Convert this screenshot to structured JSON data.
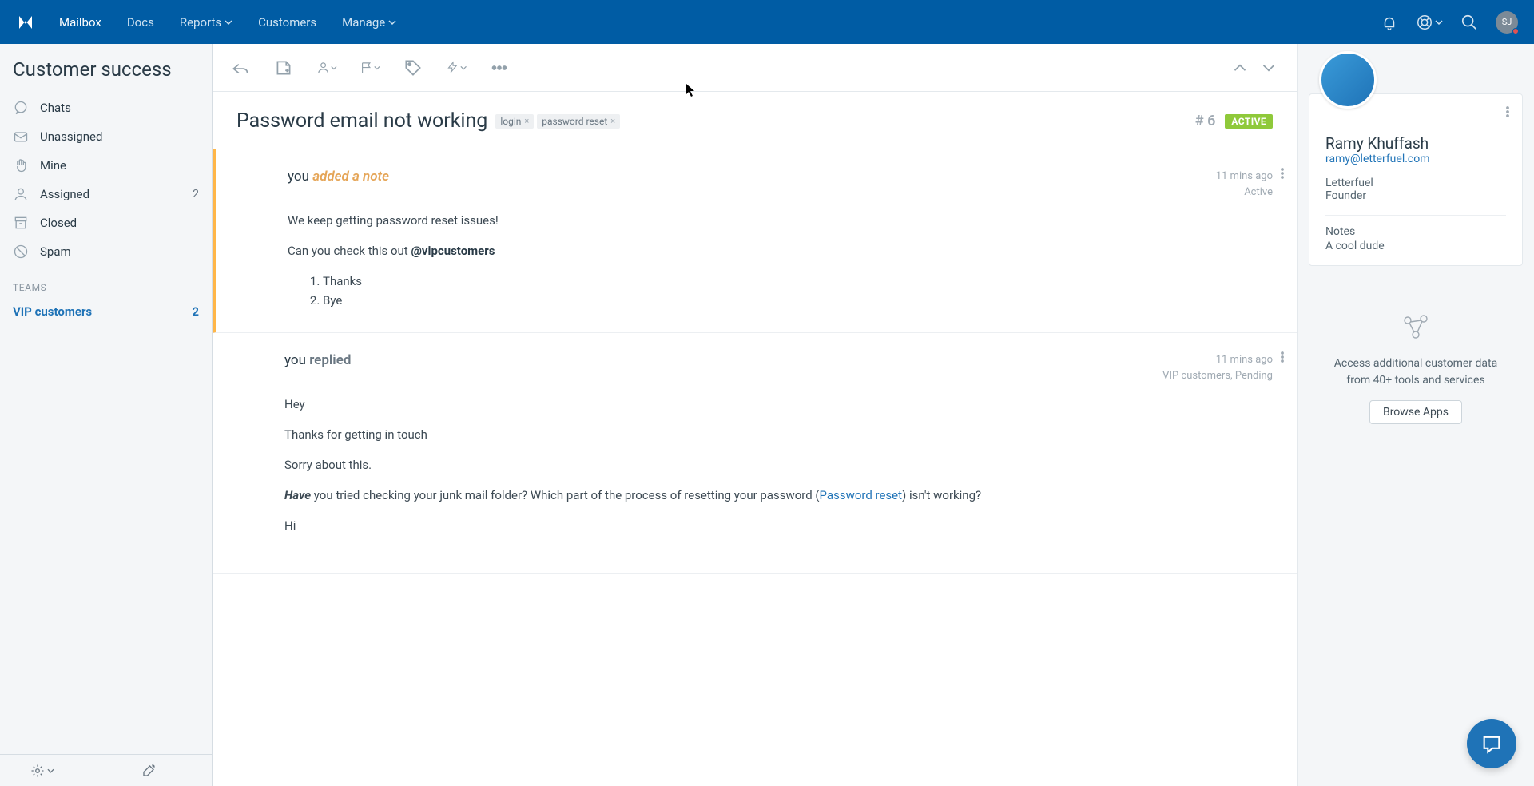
{
  "nav": {
    "mailbox": "Mailbox",
    "docs": "Docs",
    "reports": "Reports",
    "customers": "Customers",
    "manage": "Manage",
    "avatar": "SJ"
  },
  "sidebar": {
    "title": "Customer success",
    "folders": [
      {
        "label": "Chats"
      },
      {
        "label": "Unassigned"
      },
      {
        "label": "Mine"
      },
      {
        "label": "Assigned",
        "count": "2"
      },
      {
        "label": "Closed"
      },
      {
        "label": "Spam"
      }
    ],
    "teams_label": "TEAMS",
    "team": {
      "label": "VIP customers",
      "count": "2"
    }
  },
  "conversation": {
    "subject": "Password email not working",
    "tags": [
      "login",
      "password reset"
    ],
    "number": "# 6",
    "status": "ACTIVE"
  },
  "posts": [
    {
      "author": "you",
      "action": "added a note",
      "time": "11 mins ago",
      "meta2": "Active",
      "line1": "We keep getting password reset issues!",
      "line2_pre": "Can you check this out ",
      "mention": "@vipcustomers",
      "li1": "Thanks",
      "li2": "Bye"
    },
    {
      "author": "you",
      "action": "replied",
      "time": "11 mins ago",
      "meta2": "VIP customers, Pending",
      "p1": "Hey",
      "p2": "Thanks for getting in touch",
      "p3": "Sorry about this.",
      "p4_bold": "Have",
      "p4_mid": " you tried checking your junk mail folder? Which part of the process of resetting your password (",
      "p4_link": "Password reset",
      "p4_end": ") isn't working?",
      "p5": "Hi"
    }
  ],
  "customer": {
    "name": "Ramy Khuffash",
    "email": "ramy@letterfuel.com",
    "company": "Letterfuel",
    "title": "Founder",
    "notes_label": "Notes",
    "notes_text": "A cool dude"
  },
  "apps": {
    "text": "Access additional customer data from 40+ tools and services",
    "button": "Browse Apps"
  }
}
